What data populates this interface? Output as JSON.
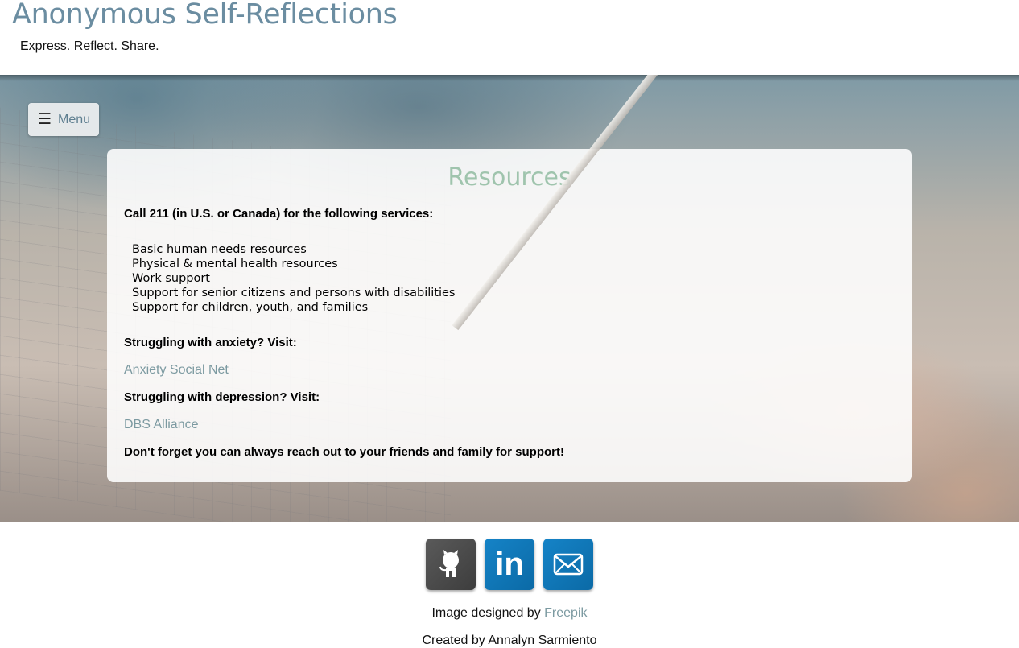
{
  "header": {
    "title": "Anonymous Self-Reflections",
    "tagline": "Express. Reflect. Share."
  },
  "menu": {
    "icon": "hamburger-icon",
    "label": "Menu"
  },
  "resources": {
    "title": "Resources",
    "call_heading": "Call 211 (in U.S. or Canada) for the following services:",
    "services": [
      "Basic human needs resources",
      "Physical & mental health resources",
      "Work support",
      "Support for senior citizens and persons with disabilities",
      "Support for children, youth, and families"
    ],
    "anxiety_heading": "Struggling with anxiety? Visit:",
    "anxiety_link": "Anxiety Social Net",
    "depression_heading": "Struggling with depression? Visit:",
    "depression_link": "DBS Alliance",
    "closing": "Don't forget you can always reach out to your friends and family for support!"
  },
  "footer": {
    "social": [
      {
        "name": "github",
        "icon": "github-icon"
      },
      {
        "name": "linkedin",
        "icon": "linkedin-icon",
        "glyph": "in"
      },
      {
        "name": "email",
        "icon": "mail-icon"
      }
    ],
    "credit_prefix": "Image designed by",
    "credit_link": "Freepik",
    "created": "Created by Annalyn Sarmiento"
  },
  "colors": {
    "title": "#6b8da1",
    "panel_title": "#9fc4ad",
    "link": "#7c9aa1",
    "linkedin_blue": "#0b6aa6",
    "github_gray": "#4a4a4a"
  }
}
